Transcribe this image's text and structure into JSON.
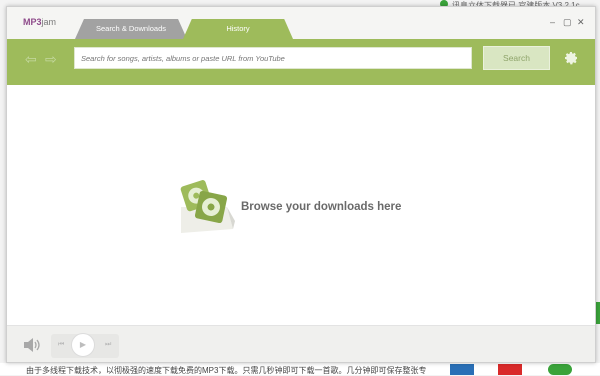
{
  "app": {
    "logo_prefix": "MP3",
    "logo_suffix": "jam"
  },
  "tabs": [
    {
      "label": "Search & Downloads"
    },
    {
      "label": "History"
    }
  ],
  "window_controls": {
    "minimize": "–",
    "restore": "▢",
    "close": "✕"
  },
  "search": {
    "placeholder": "Search for songs, artists, albums or paste URL from YouTube",
    "button_label": "Search"
  },
  "nav": {
    "back": "⇦",
    "forward": "⇨"
  },
  "empty_state": {
    "message": "Browse your downloads here"
  },
  "player": {
    "prev": "⏮",
    "play": "▶",
    "next": "⏭"
  },
  "background_page": {
    "top_text": "讯息立体下载器已 官建版本 V3.2.1c",
    "bottom_text": "由于多线程下载技术，以彻极强的速度下载免费的MP3下载。只需几秒钟即可下载一首歌。几分钟即可保存整张专"
  },
  "colors": {
    "accent_green": "#9ebb5b",
    "logo_purple": "#8e4a8a"
  }
}
